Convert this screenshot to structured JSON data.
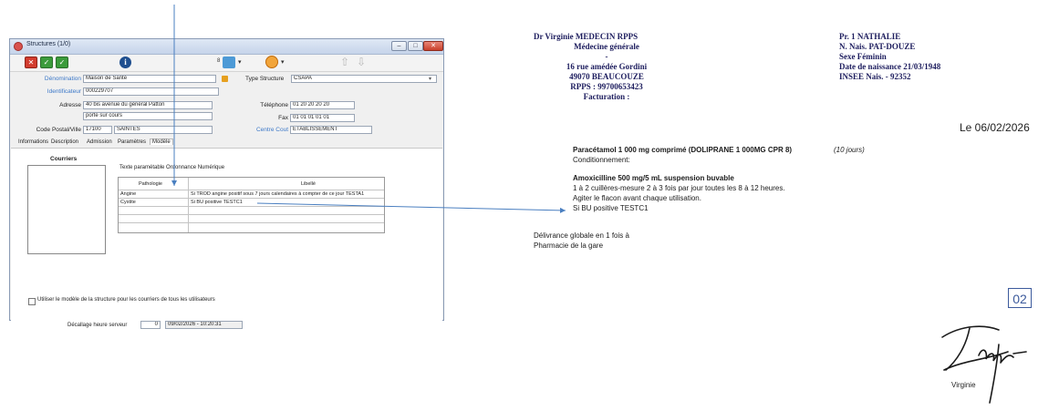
{
  "window": {
    "title": "Structures (1/0)",
    "controls": {
      "minimize": "–",
      "maximize": "□",
      "close": "✕"
    }
  },
  "toolbar": {
    "icons": [
      "delete-icon",
      "validate-icon",
      "validate-all-icon",
      "info-icon",
      "print-icon",
      "alarm-icon",
      "up-arrow-icon",
      "down-arrow-icon"
    ],
    "print_badge": "8",
    "caret": "▾",
    "info_glyph": "i",
    "arrow_up": "⇧",
    "arrow_down": "⇩"
  },
  "form": {
    "denomination_label": "Dénomination",
    "denomination_value": "Maison de Santé",
    "identificateur_label": "Identificateur",
    "identificateur_value": "000229707",
    "adresse_label": "Adresse",
    "adresse_line1": "40 bis avenue du général Patton",
    "adresse_line2": "porte sur cours",
    "cp_ville_label": "Code Postal/Ville",
    "code_postal": "17100",
    "ville": "SAINTES",
    "type_structure_label": "Type Structure",
    "type_structure_value": "CSAPA",
    "telephone_label": "Téléphone",
    "telephone_value": "01 20 20 20 20",
    "fax_label": "Fax",
    "fax_value": "01 01 01 01 01",
    "centre_cout_label": "Centre Cout",
    "centre_cout_value": "ETABLISSEMENT"
  },
  "tabs": [
    "Informations",
    "Description",
    "Admission",
    "Paramètres",
    "Modèle"
  ],
  "active_tab": "Modèle",
  "modele": {
    "courriers_label": "Courriers",
    "grid_title": "Texte paramétable Ordonnance Numérique",
    "columns": [
      "Pathologie",
      "Libellé"
    ],
    "rows": [
      {
        "pathologie": "Angine",
        "libelle": "Si TROD angine positif sous 7 jours calendaires à compter de ce jour TESTA1"
      },
      {
        "pathologie": "Cystite",
        "libelle": "Si BU positive TESTC1"
      }
    ],
    "checkbox_label": "Utiliser le modèle de la structure pour les courriers de tous les utilisateurs",
    "decalage_label": "Décallage heure serveur",
    "decalage_value": "0",
    "server_datetime": "09/02/2026 - 10:20:31"
  },
  "prescription": {
    "doctor": {
      "line1": "Dr Virginie MEDECIN RPPS",
      "line2": "Médecine générale",
      "line3": "-",
      "line4": "16 rue amédée Gordini",
      "line5": "49070 BEAUCOUZE",
      "line6": "RPPS : 99700653423",
      "line7": "Facturation :"
    },
    "patient": {
      "line1": "Pr. 1 NATHALIE",
      "line2": "N. Nais. PAT-DOUZE",
      "line3": "Sexe Féminin",
      "line4": "Date de naissance 21/03/1948",
      "line5": "INSEE Nais.  - 92352"
    },
    "date": "Le 06/02/2026",
    "med1": {
      "name": "Paracétamol 1 000 mg comprimé  (DOLIPRANE 1 000MG CPR 8)",
      "duration": "(10 jours)",
      "detail": "Conditionnement:"
    },
    "med2": {
      "name": "Amoxicilline 500 mg/5 mL suspension buvable",
      "dosage": "1 à 2 cuillères-mesure 2 à 3 fois par jour toutes les 8 à 12 heures.",
      "instruction": "Agiter le flacon avant chaque utilisation.",
      "condition": "Si BU positive TESTC1"
    },
    "delivery_line1": "Délivrance globale en 1 fois  à",
    "delivery_line2": "Pharmacie de la gare",
    "page_number": "02",
    "signature_name": "Virginie"
  },
  "colors": {
    "accent": "#3c78c8",
    "arrow": "#4a7fc0",
    "window_border": "#8a9bb5"
  }
}
